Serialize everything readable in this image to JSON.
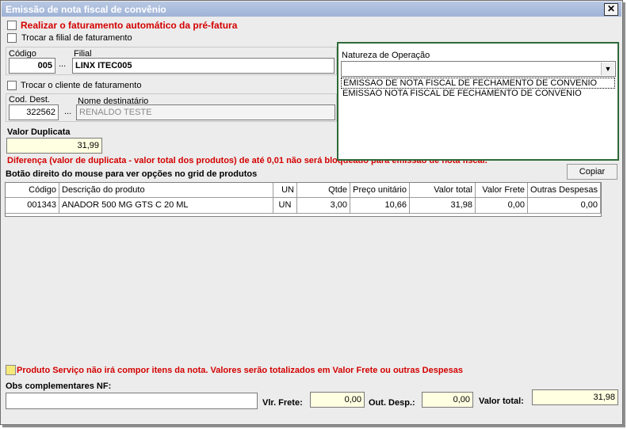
{
  "window": {
    "title": "Emissão de nota fiscal de convênio",
    "close_glyph": "✕"
  },
  "options": {
    "auto_billing": "Realizar o faturamento automático da pré-fatura",
    "change_branch": "Trocar a filial de faturamento",
    "change_client": "Trocar o cliente de faturamento"
  },
  "branch": {
    "code_label": "Código",
    "code_value": "005",
    "lookup": "...",
    "name_label": "Filial",
    "name_value": "LINX ITEC005"
  },
  "client": {
    "code_label": "Cod. Dest.",
    "code_value": "322562",
    "lookup": "...",
    "name_label": "Nome destinatário",
    "name_value": "RENALDO TESTE"
  },
  "duplicate": {
    "label": "Valor Duplicata",
    "value": "31,99"
  },
  "warning": "Diferença (valor de duplicata - valor total dos produtos) de até 0,01 não será bloqueado para emissão de nota fiscal.",
  "grid_hint": "Botão direito do mouse para ver opções no grid de produtos",
  "copy_button": "Copiar",
  "grid": {
    "columns": [
      "Código",
      "Descrição do produto",
      "UN",
      "Qtde",
      "Preço unitário",
      "Valor total",
      "Valor Frete",
      "Outras Despesas"
    ],
    "rows": [
      [
        "001343",
        "ANADOR 500 MG GTS C 20 ML",
        "UN",
        "3,00",
        "10,66",
        "31,98",
        "0,00",
        "0,00"
      ]
    ]
  },
  "natureza": {
    "label": "Natureza de Operação",
    "options": [
      "EMISSAO DE NOTA FISCAL DE FECHAMENTO DE CONVENIO",
      "EMISSAO NOTA FISCAL DE FECHAMENTO DE CONVENIO"
    ]
  },
  "legend": "Produto Serviço não irá compor itens da nota. Valores serão totalizados em Valor Frete ou outras Despesas",
  "footer": {
    "obs_label": "Obs complementares NF:",
    "obs_value": "",
    "frete_label": "Vlr. Frete:",
    "frete_value": "0,00",
    "desp_label": "Out. Desp.:",
    "desp_value": "0,00",
    "total_label": "Valor total:",
    "total_value": "31,98"
  },
  "colors": {
    "warning": "#d40000",
    "highlight_field": "#ffffe1",
    "panel_border": "#2f6a3a",
    "legend_swatch": "#f5e97a"
  },
  "icons": [
    "close-icon",
    "chevron-down-icon"
  ]
}
